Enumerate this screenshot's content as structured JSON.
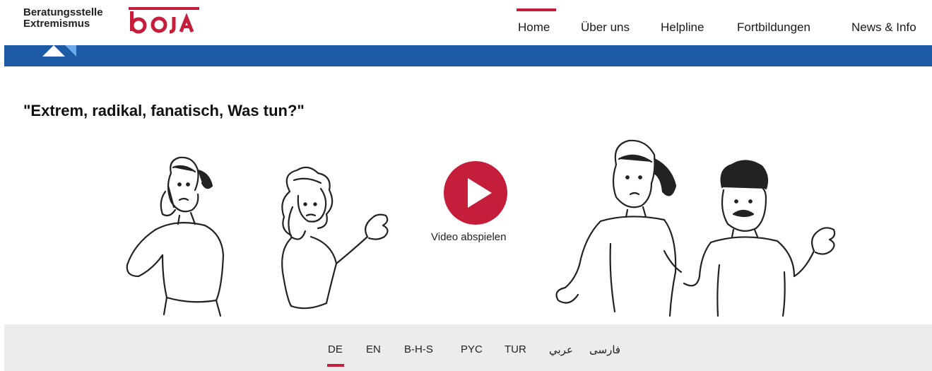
{
  "brand": {
    "line1": "Beratungsstelle",
    "line2": "Extremismus",
    "logo_word": "boJA",
    "logo_color": "#c41e3a"
  },
  "nav": {
    "items": [
      {
        "label": "Home",
        "active": true
      },
      {
        "label": "Über uns"
      },
      {
        "label": "Helpline"
      },
      {
        "label": "Fortbildungen"
      },
      {
        "label": "News & Info"
      }
    ]
  },
  "banner": {
    "color": "#1d5aa6"
  },
  "headline": "\"Extrem, radikal, fanatisch, Was tun?\"",
  "video": {
    "play_label": "Video abspielen",
    "play_icon": "play-icon",
    "accent": "#c41e3a"
  },
  "languages": {
    "items": [
      "DE",
      "EN",
      "B-H-S",
      "PYC",
      "TUR",
      "عربي",
      "فارسی"
    ],
    "active": "DE"
  }
}
